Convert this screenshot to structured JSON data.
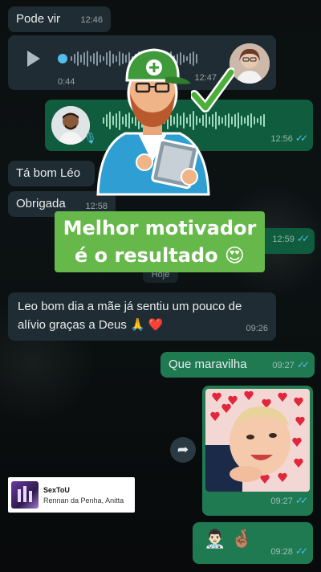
{
  "chat": {
    "messages": [
      {
        "text": "Pode vir",
        "time": "12:46"
      },
      {
        "duration": "0:44",
        "time": "12:47"
      },
      {
        "time": "12:56"
      },
      {
        "text": "Tá bom Léo"
      },
      {
        "text": "Obrigada",
        "time": "12:58"
      },
      {
        "time": "12:59"
      },
      {
        "text": "Leo  bom dia a mãe já sentiu um pouco de alívio graças a Deus 🙏 ❤️",
        "time": "09:26"
      },
      {
        "text": "Que maravilha",
        "time": "09:27"
      },
      {
        "time": "09:27"
      },
      {
        "text": "👨🏻‍⚕️ 🤞🏽",
        "time": "09:28"
      }
    ],
    "date_divider": "Hoje"
  },
  "promo": {
    "line1": "Melhor motivador",
    "line2": "é o  resultado 😍"
  },
  "music": {
    "title": "SexToU",
    "artist": "Rennan da Penha, Anitta"
  },
  "icons": {
    "play": "play-icon",
    "mic": "microphone-icon",
    "share": "forward-icon",
    "read": "double-check-icon"
  },
  "colors": {
    "incoming": "#202c33",
    "outgoing": "#1f7a52",
    "promo": "#66b84a",
    "read_ticks": "#53bdeb"
  }
}
